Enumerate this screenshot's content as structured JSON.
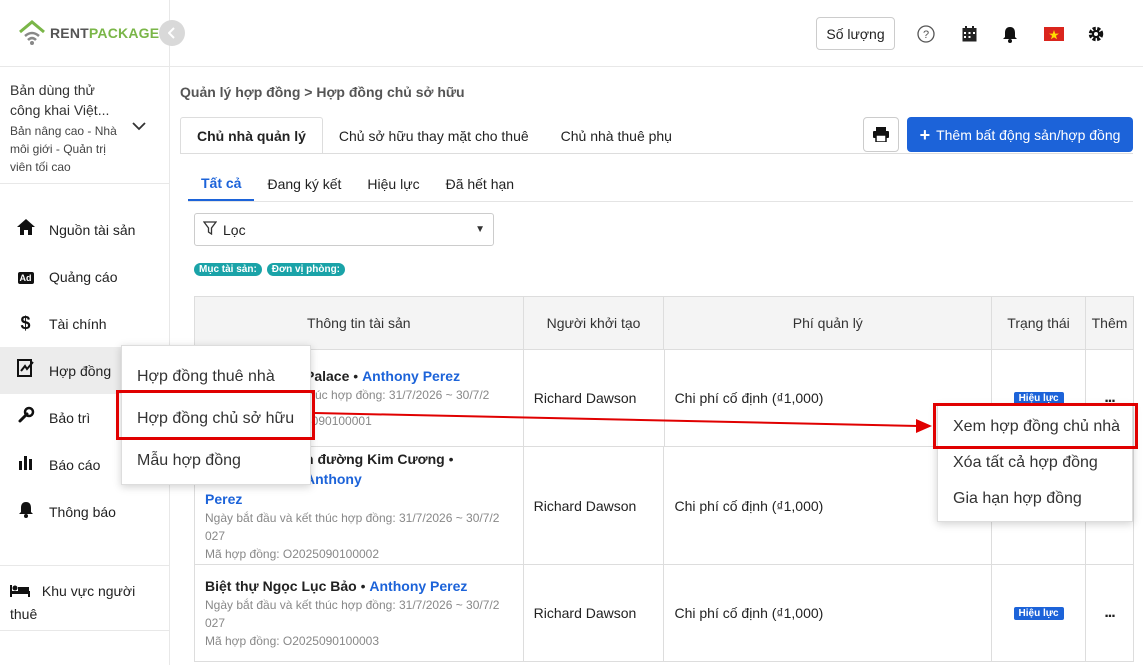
{
  "brand": {
    "rent": "RENT",
    "package": "PACKAGE"
  },
  "plan": {
    "name": "Bản dùng thử công khai Việt...",
    "subtitle": "Bản nâng cao - Nhà môi giới - Quản trị viên tối cao"
  },
  "sidebar": {
    "items": [
      {
        "label": "Nguồn tài sản",
        "icon": "home-icon"
      },
      {
        "label": "Quảng cáo",
        "icon": "ad-icon"
      },
      {
        "label": "Tài chính",
        "icon": "dollar-icon"
      },
      {
        "label": "Hợp đồng",
        "icon": "contract-icon"
      },
      {
        "label": "Bảo trì",
        "icon": "wrench-icon"
      },
      {
        "label": "Báo cáo",
        "icon": "chart-icon"
      },
      {
        "label": "Thông báo",
        "icon": "bell-icon"
      }
    ],
    "tenant_area": "Khu vực người thuê"
  },
  "header": {
    "quantity_label": "Số lượng"
  },
  "breadcrumb": "Quản lý hợp đồng > Hợp đồng chủ sở hữu",
  "top_tabs": [
    "Chủ nhà quản lý",
    "Chủ sở hữu thay mặt cho thuê",
    "Chủ nhà thuê phụ"
  ],
  "add_button": "Thêm bất động sản/hợp đồng",
  "sub_tabs": [
    "Tất cả",
    "Đang ký kết",
    "Hiệu lực",
    "Đã hết hạn"
  ],
  "filter": {
    "label": "Lọc"
  },
  "chips": [
    "Mục tài sản:",
    "Đơn vị phòng:"
  ],
  "table": {
    "headers": [
      "Thông tin tài sản",
      "Người khởi tạo",
      "Phí quản lý",
      "Trạng thái",
      "Thêm"
    ],
    "rows": [
      {
        "name": "Palace",
        "owner": "Anthony Perez",
        "dates": "thúc hợp đồng: 31/7/2026 ~ 30/7/2",
        "code": "5090100001",
        "creator": "Richard Dawson",
        "fee": "Chi phí cố định (₫1,000)",
        "status": "Hiệu lực"
      },
      {
        "name": "n đường Kim Cương",
        "owner": "Anthony",
        "owner2": "Perez",
        "dates": "Ngày bắt đầu và kết thúc hợp đồng: 31/7/2026 ~ 30/7/2",
        "dates2": "027",
        "code": "Mã hợp đồng: O2025090100002",
        "creator": "Richard Dawson",
        "fee": "Chi phí cố định (₫1,000)",
        "status": ""
      },
      {
        "name": "Biệt thự Ngọc Lục Bảo",
        "owner": "Anthony Perez",
        "dates": "Ngày bắt đầu và kết thúc hợp đồng: 31/7/2026 ~ 30/7/2",
        "dates2": "027",
        "code": "Mã hợp đồng: O2025090100003",
        "creator": "Richard Dawson",
        "fee": "Chi phí cố định (₫1,000)",
        "status": "Hiệu lực"
      }
    ],
    "more_label": "...",
    "separator": "•"
  },
  "submenu": [
    "Hợp đồng thuê nhà",
    "Hợp đồng chủ sở hữu",
    "Mẫu hợp đồng"
  ],
  "actions_menu": [
    "Xem hợp đồng chủ nhà",
    "Xóa tất cả hợp đồng",
    "Gia hạn hợp đồng"
  ],
  "colors": {
    "primary": "#1c63d9",
    "brand_green": "#7ab648",
    "highlight": "#e00000",
    "chip": "#1aa3a8"
  }
}
